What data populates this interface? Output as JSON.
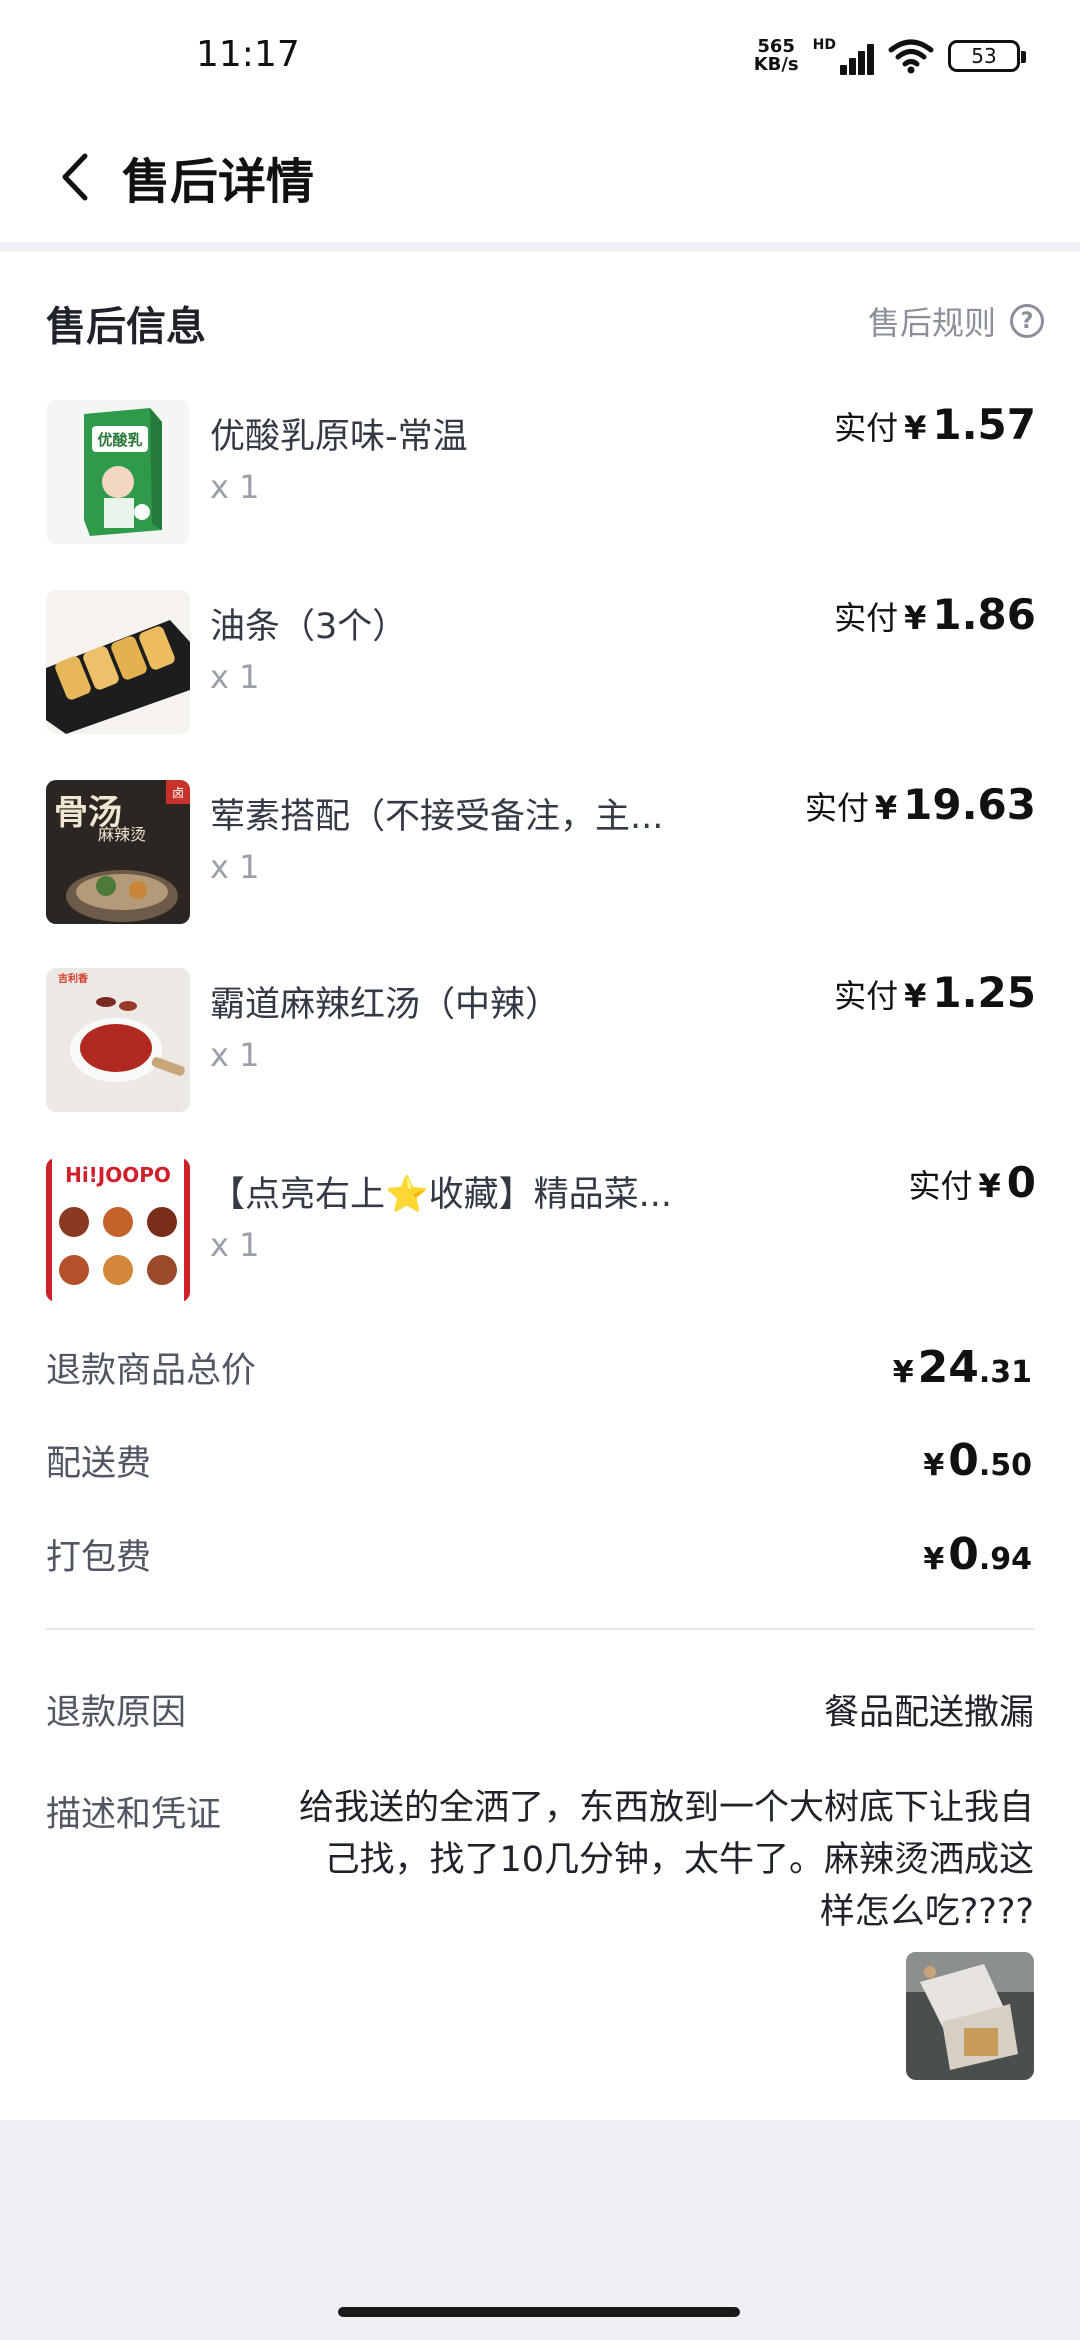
{
  "status_bar": {
    "time": "11:17",
    "net_speed_value": "565",
    "net_speed_unit": "KB/s",
    "hd_label": "HD",
    "battery": "53"
  },
  "nav": {
    "title": "售后详情"
  },
  "section": {
    "title": "售后信息",
    "rules_label": "售后规则"
  },
  "products": [
    {
      "name": "优酸乳原味-常温",
      "qty": "x 1",
      "price_label": "实付",
      "currency": "¥",
      "amount": "1.57"
    },
    {
      "name": "油条（3个）",
      "qty": "x 1",
      "price_label": "实付",
      "currency": "¥",
      "amount": "1.86"
    },
    {
      "name": "荤素搭配（不接受备注，主...",
      "qty": "x 1",
      "price_label": "实付",
      "currency": "¥",
      "amount": "19.63"
    },
    {
      "name": "霸道麻辣红汤（中辣）",
      "qty": "x 1",
      "price_label": "实付",
      "currency": "¥",
      "amount": "1.25"
    },
    {
      "name": "【点亮右上⭐收藏】精品菜...",
      "qty": "x 1",
      "price_label": "实付",
      "currency": "¥",
      "amount": "0"
    }
  ],
  "image_texts": {
    "milk_brand": "优酸乳",
    "soup_big": "骨汤",
    "soup_small": "麻辣烫",
    "soup_brand_logo": "卤",
    "joopo_brand": "Hi!JOOPO",
    "redsoup_brand": "吉利香"
  },
  "fees": [
    {
      "label": "退款商品总价",
      "currency": "¥",
      "amount_int": "24",
      "amount_dec": ".31"
    },
    {
      "label": "配送费",
      "currency": "¥",
      "amount_int": "0",
      "amount_dec": ".50"
    },
    {
      "label": "打包费",
      "currency": "¥",
      "amount_int": "0",
      "amount_dec": ".94"
    }
  ],
  "refund": {
    "reason_label": "退款原因",
    "reason_value": "餐品配送撒漏",
    "desc_label": "描述和凭证",
    "desc_text": "给我送的全洒了，东西放到一个大树底下让我自己找，找了10几分钟，太牛了。麻辣烫洒成这样怎么吃????"
  },
  "colors": {
    "page_bg": "#eef0f5",
    "card_bg": "#ffffff",
    "muted_text": "#8a8f99",
    "primary_text": "#1f2329"
  }
}
